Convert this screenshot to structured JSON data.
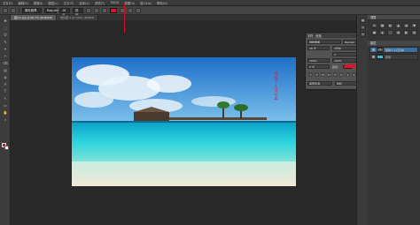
{
  "menubar": {
    "items": [
      "文件(F)",
      "编辑(E)",
      "图像(I)",
      "图层(L)",
      "文字(Y)",
      "选择(S)",
      "滤镜(T)",
      "3D(D)",
      "视图(V)",
      "窗口(W)",
      "帮助(H)"
    ]
  },
  "options": {
    "font_family": "微软雅黑",
    "font_style": "Regular",
    "font_size": "18 点",
    "aa_mode": "锐利"
  },
  "doc_tabs": [
    {
      "label": "图片1.jpg @ 66.7% (RGB/8#)",
      "active": true
    },
    {
      "label": "未标题-1 @ 100% (RGB/8)",
      "active": false
    }
  ],
  "canvas": {
    "vertical_text": "我的个人日记本"
  },
  "character_panel": {
    "tab_character": "字符",
    "tab_paragraph": "段落",
    "font": "微软雅黑",
    "font_style": "Regular",
    "size": "18 点",
    "leading": "(自动)",
    "tracking": "0",
    "scale_v": "100%",
    "scale_h": "100%",
    "baseline": "0 点",
    "color_label": "颜色:",
    "language": "美国英语",
    "antialias": "锐利"
  },
  "right_panels": {
    "top_header": "调整",
    "buttons": [
      "☀",
      "▦",
      "◐",
      "▲",
      "◑",
      "▼",
      "▣",
      "◈",
      "⬚",
      "▤",
      "◧",
      "▨"
    ],
    "layers_header": "图层",
    "layers": [
      {
        "name": "我的个人日记本",
        "type": "text",
        "active": true
      },
      {
        "name": "背景",
        "type": "image",
        "active": false
      }
    ]
  },
  "toolbox": {
    "tools": [
      "✥",
      "⬚",
      "ʘ",
      "✎",
      "⌖",
      "✂",
      "⌫",
      "▤",
      "◍",
      "✐",
      "T",
      "↖",
      "▭",
      "✋",
      "⌕"
    ]
  },
  "colors": {
    "foreground": "#e2112f",
    "background": "#ffffff",
    "accent_red": "#e2112f"
  }
}
